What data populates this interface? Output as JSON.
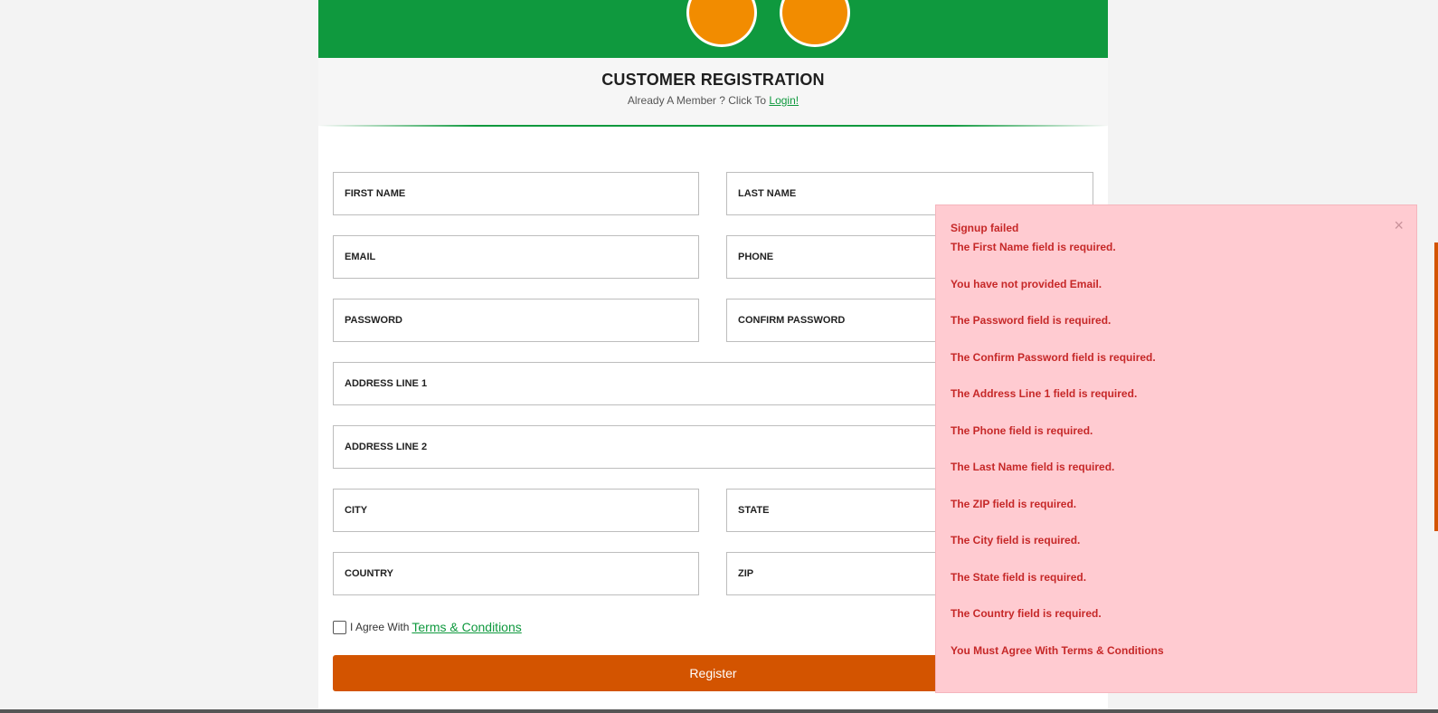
{
  "header": {
    "title": "CUSTOMER REGISTRATION",
    "subtitle_prefix": "Already A Member ? Click To",
    "login_link": "Login!"
  },
  "form": {
    "first_name": "FIRST NAME",
    "last_name": "LAST NAME",
    "email": "EMAIL",
    "phone": "PHONE",
    "password": "PASSWORD",
    "confirm_password": "CONFIRM PASSWORD",
    "address_line_1": "ADDRESS LINE 1",
    "address_line_2": "ADDRESS LINE 2",
    "city": "CITY",
    "state": "STATE",
    "country": "COUNTRY",
    "zip": "ZIP",
    "agree_prefix": "I Agree With",
    "terms_link": "Terms & Conditions",
    "register_label": "Register"
  },
  "alert": {
    "title": "Signup failed",
    "close": "×",
    "messages": [
      "The First Name field is required.",
      "You have not provided Email.",
      "The Password field is required.",
      "The Confirm Password field is required.",
      "The Address Line 1 field is required.",
      "The Phone field is required.",
      "The Last Name field is required.",
      "The ZIP field is required.",
      "The City field is required.",
      "The State field is required.",
      "The Country field is required.",
      "You Must Agree With Terms & Conditions"
    ]
  },
  "colors": {
    "brand_green": "#0f993e",
    "accent_orange": "#d35400",
    "bubble_orange": "#f28c00",
    "alert_bg": "#ffcbd1",
    "alert_text": "#c62828"
  }
}
